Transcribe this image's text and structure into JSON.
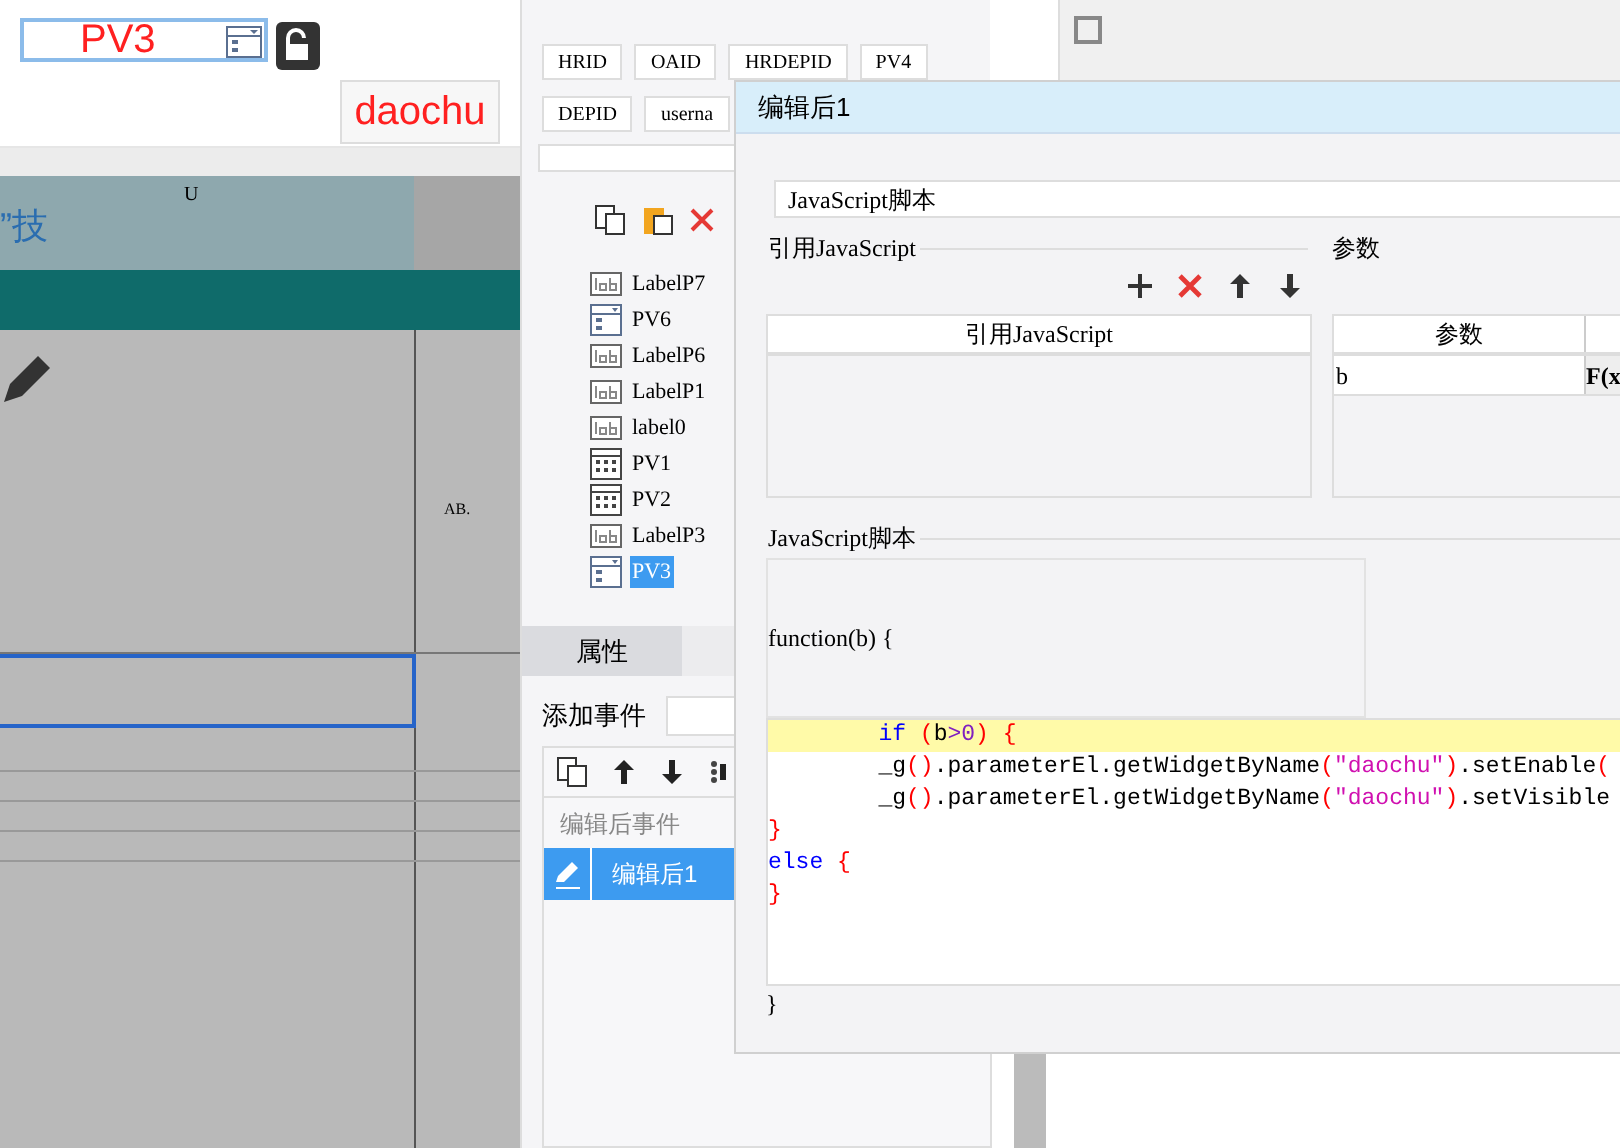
{
  "canvas": {
    "widget_label": "PV3",
    "button_label": "daochu",
    "column_header": "U",
    "heading_fragment": "”技",
    "cell_fragment": "AB."
  },
  "parameters_panel": {
    "buttons": [
      "HRID",
      "OAID",
      "HRDEPID",
      "PV4",
      "DEPID",
      "userna"
    ]
  },
  "widget_tree": {
    "items": [
      {
        "label": "LabelP7",
        "kind": "label",
        "selected": false
      },
      {
        "label": "PV6",
        "kind": "combo",
        "selected": false
      },
      {
        "label": "LabelP6",
        "kind": "label",
        "selected": false
      },
      {
        "label": "LabelP1",
        "kind": "label",
        "selected": false
      },
      {
        "label": "label0",
        "kind": "label",
        "selected": false
      },
      {
        "label": "PV1",
        "kind": "date",
        "selected": false
      },
      {
        "label": "PV2",
        "kind": "date",
        "selected": false
      },
      {
        "label": "LabelP3",
        "kind": "label",
        "selected": false
      },
      {
        "label": "PV3",
        "kind": "combo",
        "selected": true
      }
    ]
  },
  "tabs": [
    {
      "label": "属性",
      "selected": true
    }
  ],
  "events": {
    "add_label": "添加事件",
    "group_label": "编辑后事件",
    "items": [
      {
        "label": "编辑后1",
        "selected": true
      }
    ]
  },
  "dialog": {
    "title": "编辑后1",
    "type_field": "JavaScript脚本",
    "imports_group": "引用JavaScript",
    "imports_column": "引用JavaScript",
    "params_group": "参数",
    "params_column": "参数",
    "params": [
      {
        "name": "b",
        "formula": "F(x"
      }
    ],
    "script_group": "JavaScript脚本",
    "signature": "function(b) {",
    "code_lines": [
      {
        "highlighted": true,
        "tokens": [
          {
            "text": "        if ",
            "kind": "keyword"
          },
          {
            "text": "(",
            "kind": "paren"
          },
          {
            "text": "b",
            "kind": "plain"
          },
          {
            "text": ">0",
            "kind": "number"
          },
          {
            "text": ") {",
            "kind": "paren"
          }
        ]
      },
      {
        "highlighted": false,
        "tokens": [
          {
            "text": "        _g",
            "kind": "plain"
          },
          {
            "text": "()",
            "kind": "paren"
          },
          {
            "text": ".parameterEl.getWidgetByName",
            "kind": "plain"
          },
          {
            "text": "(",
            "kind": "paren"
          },
          {
            "text": "\"daochu\"",
            "kind": "string"
          },
          {
            "text": ")",
            "kind": "paren"
          },
          {
            "text": ".setEnable",
            "kind": "plain"
          },
          {
            "text": "(",
            "kind": "paren"
          }
        ]
      },
      {
        "highlighted": false,
        "tokens": [
          {
            "text": "        _g",
            "kind": "plain"
          },
          {
            "text": "()",
            "kind": "paren"
          },
          {
            "text": ".parameterEl.getWidgetByName",
            "kind": "plain"
          },
          {
            "text": "(",
            "kind": "paren"
          },
          {
            "text": "\"daochu\"",
            "kind": "string"
          },
          {
            "text": ")",
            "kind": "paren"
          },
          {
            "text": ".setVisible",
            "kind": "plain"
          }
        ]
      },
      {
        "highlighted": false,
        "tokens": [
          {
            "text": "}",
            "kind": "paren"
          }
        ]
      },
      {
        "highlighted": false,
        "tokens": [
          {
            "text": "else ",
            "kind": "keyword"
          },
          {
            "text": "{",
            "kind": "paren"
          }
        ]
      },
      {
        "highlighted": false,
        "tokens": [
          {
            "text": "}",
            "kind": "paren"
          }
        ]
      }
    ],
    "closing": "}"
  }
}
